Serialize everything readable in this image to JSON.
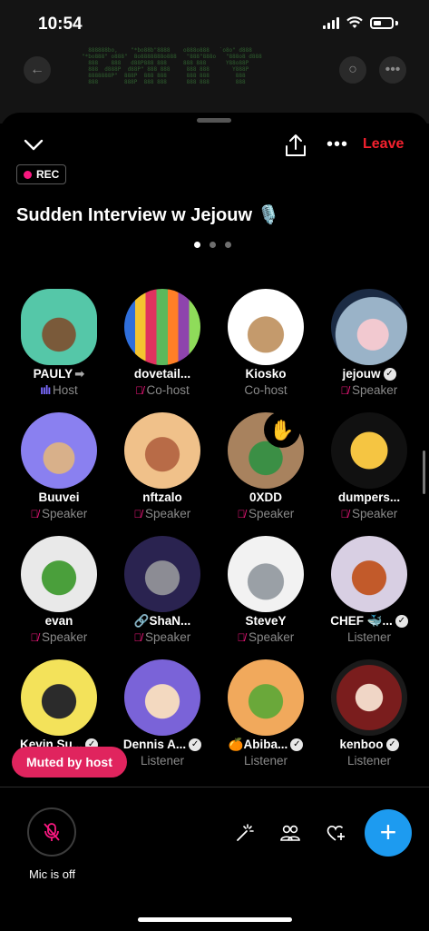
{
  "status": {
    "time": "10:54"
  },
  "space": {
    "rec_label": "REC",
    "title": "Sudden Interview w Jejouw",
    "title_emoji": "🎙️",
    "leave_label": "Leave"
  },
  "participants": [
    {
      "name": "PAULY",
      "role": "Host",
      "name_suffix": "➡",
      "muted": false,
      "verified": false
    },
    {
      "name": "dovetail...",
      "role": "Co-host",
      "muted": true,
      "verified": false
    },
    {
      "name": "Kiosko",
      "role": "Co-host",
      "muted": false,
      "verified": false
    },
    {
      "name": "jejouw",
      "role": "Speaker",
      "muted": true,
      "verified": true
    },
    {
      "name": "Buuvei",
      "role": "Speaker",
      "muted": true,
      "verified": false
    },
    {
      "name": "nftzalo",
      "role": "Speaker",
      "muted": true,
      "verified": false
    },
    {
      "name": "0XDD",
      "role": "Speaker",
      "muted": true,
      "verified": false
    },
    {
      "name": "dumpers...",
      "role": "Speaker",
      "muted": true,
      "verified": false
    },
    {
      "name": "evan",
      "role": "Speaker",
      "muted": true,
      "verified": false
    },
    {
      "name": "ShaN...",
      "name_prefix": "🔗",
      "role": "Speaker",
      "muted": true,
      "verified": false
    },
    {
      "name": "SteveY",
      "role": "Speaker",
      "muted": true,
      "verified": false
    },
    {
      "name": "CHEF 🐳...",
      "role": "Listener",
      "muted": false,
      "verified": true
    },
    {
      "name": "Kevin Su...",
      "role": "",
      "muted": false,
      "verified": true
    },
    {
      "name": "Dennis A...",
      "role": "Listener",
      "muted": false,
      "verified": true
    },
    {
      "name": "Abiba...",
      "name_prefix": "🍊",
      "role": "Listener",
      "muted": false,
      "verified": true
    },
    {
      "name": "kenboo",
      "role": "Listener",
      "muted": false,
      "verified": true
    }
  ],
  "toast": {
    "label": "Muted by host"
  },
  "bottom_bar": {
    "mic_label": "Mic is off"
  },
  "colors": {
    "accent": "#1d9bf0",
    "leave": "#f4212e",
    "rec": "#f91880",
    "toast": "#e0245e"
  }
}
